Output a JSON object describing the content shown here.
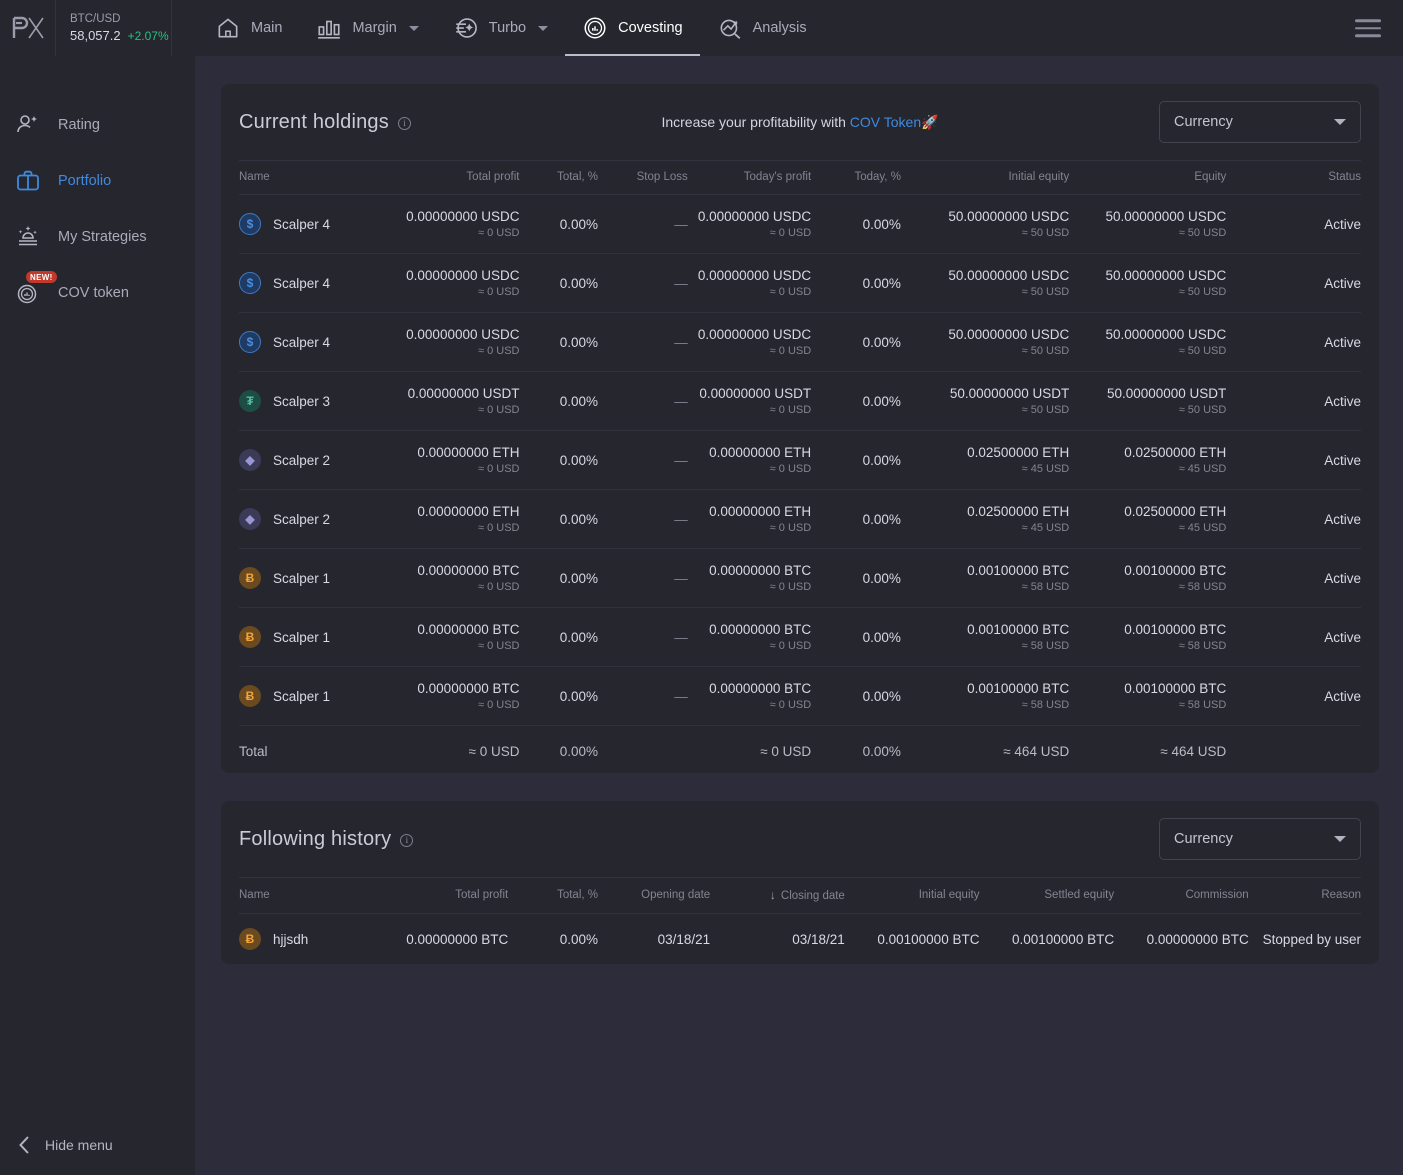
{
  "topbar": {
    "logo": "px-logo",
    "ticker": {
      "pair": "BTC/USD",
      "price": "58,057.2",
      "change": "+2.07%",
      "change_color": "#26c281"
    },
    "nav": [
      {
        "label": "Main",
        "icon": "home-icon",
        "has_caret": false,
        "active": false
      },
      {
        "label": "Margin",
        "icon": "bar-chart-icon",
        "has_caret": true,
        "active": false
      },
      {
        "label": "Turbo",
        "icon": "turbo-icon",
        "has_caret": true,
        "active": false
      },
      {
        "label": "Covesting",
        "icon": "covesting-icon",
        "has_caret": false,
        "active": true
      },
      {
        "label": "Analysis",
        "icon": "analysis-icon",
        "has_caret": false,
        "active": false
      }
    ],
    "menu_icon": "hamburger-icon"
  },
  "sidebar": {
    "items": [
      {
        "label": "Rating",
        "icon": "rating-user-icon",
        "active": false,
        "badge": ""
      },
      {
        "label": "Portfolio",
        "icon": "briefcase-icon",
        "active": true,
        "badge": ""
      },
      {
        "label": "My Strategies",
        "icon": "strategies-icon",
        "active": false,
        "badge": ""
      },
      {
        "label": "COV token",
        "icon": "cov-token-icon",
        "active": false,
        "badge": "NEW!"
      }
    ],
    "hide_menu": {
      "label": "Hide menu",
      "icon": "chevron-left-icon"
    },
    "accent_color": "#3f8ae0"
  },
  "holdings": {
    "title": "Current holdings",
    "info_icon": "info-icon",
    "promo_prefix": "Increase your profitability with ",
    "promo_link": "COV Token",
    "promo_emoji": "🚀",
    "currency_select": {
      "value": "Currency",
      "icon": "chevron-down-icon"
    },
    "columns": [
      "Name",
      "Total profit",
      "Total, %",
      "Stop Loss",
      "Today's profit",
      "Today, %",
      "Initial equity",
      "Equity",
      "Status"
    ],
    "rows": [
      {
        "coin": "usdc",
        "coin_glyph": "$",
        "name": "Scalper 4",
        "total_profit": "0.00000000 USDC",
        "total_profit_sub": "≈ 0 USD",
        "total_pct": "0.00%",
        "stop_loss": "—",
        "today_profit": "0.00000000 USDC",
        "today_profit_sub": "≈ 0 USD",
        "today_pct": "0.00%",
        "initial_equity": "50.00000000 USDC",
        "initial_equity_sub": "≈ 50 USD",
        "equity": "50.00000000 USDC",
        "equity_sub": "≈ 50 USD",
        "status": "Active"
      },
      {
        "coin": "usdc",
        "coin_glyph": "$",
        "name": "Scalper 4",
        "total_profit": "0.00000000 USDC",
        "total_profit_sub": "≈ 0 USD",
        "total_pct": "0.00%",
        "stop_loss": "—",
        "today_profit": "0.00000000 USDC",
        "today_profit_sub": "≈ 0 USD",
        "today_pct": "0.00%",
        "initial_equity": "50.00000000 USDC",
        "initial_equity_sub": "≈ 50 USD",
        "equity": "50.00000000 USDC",
        "equity_sub": "≈ 50 USD",
        "status": "Active"
      },
      {
        "coin": "usdc",
        "coin_glyph": "$",
        "name": "Scalper 4",
        "total_profit": "0.00000000 USDC",
        "total_profit_sub": "≈ 0 USD",
        "total_pct": "0.00%",
        "stop_loss": "—",
        "today_profit": "0.00000000 USDC",
        "today_profit_sub": "≈ 0 USD",
        "today_pct": "0.00%",
        "initial_equity": "50.00000000 USDC",
        "initial_equity_sub": "≈ 50 USD",
        "equity": "50.00000000 USDC",
        "equity_sub": "≈ 50 USD",
        "status": "Active"
      },
      {
        "coin": "usdt",
        "coin_glyph": "₮",
        "name": "Scalper 3",
        "total_profit": "0.00000000 USDT",
        "total_profit_sub": "≈ 0 USD",
        "total_pct": "0.00%",
        "stop_loss": "—",
        "today_profit": "0.00000000 USDT",
        "today_profit_sub": "≈ 0 USD",
        "today_pct": "0.00%",
        "initial_equity": "50.00000000 USDT",
        "initial_equity_sub": "≈ 50 USD",
        "equity": "50.00000000 USDT",
        "equity_sub": "≈ 50 USD",
        "status": "Active"
      },
      {
        "coin": "eth",
        "coin_glyph": "◆",
        "name": "Scalper 2",
        "total_profit": "0.00000000 ETH",
        "total_profit_sub": "≈ 0 USD",
        "total_pct": "0.00%",
        "stop_loss": "—",
        "today_profit": "0.00000000 ETH",
        "today_profit_sub": "≈ 0 USD",
        "today_pct": "0.00%",
        "initial_equity": "0.02500000 ETH",
        "initial_equity_sub": "≈ 45 USD",
        "equity": "0.02500000 ETH",
        "equity_sub": "≈ 45 USD",
        "status": "Active"
      },
      {
        "coin": "eth",
        "coin_glyph": "◆",
        "name": "Scalper 2",
        "total_profit": "0.00000000 ETH",
        "total_profit_sub": "≈ 0 USD",
        "total_pct": "0.00%",
        "stop_loss": "—",
        "today_profit": "0.00000000 ETH",
        "today_profit_sub": "≈ 0 USD",
        "today_pct": "0.00%",
        "initial_equity": "0.02500000 ETH",
        "initial_equity_sub": "≈ 45 USD",
        "equity": "0.02500000 ETH",
        "equity_sub": "≈ 45 USD",
        "status": "Active"
      },
      {
        "coin": "btc",
        "coin_glyph": "Ƀ",
        "name": "Scalper 1",
        "total_profit": "0.00000000 BTC",
        "total_profit_sub": "≈ 0 USD",
        "total_pct": "0.00%",
        "stop_loss": "—",
        "today_profit": "0.00000000 BTC",
        "today_profit_sub": "≈ 0 USD",
        "today_pct": "0.00%",
        "initial_equity": "0.00100000 BTC",
        "initial_equity_sub": "≈ 58 USD",
        "equity": "0.00100000 BTC",
        "equity_sub": "≈ 58 USD",
        "status": "Active"
      },
      {
        "coin": "btc",
        "coin_glyph": "Ƀ",
        "name": "Scalper 1",
        "total_profit": "0.00000000 BTC",
        "total_profit_sub": "≈ 0 USD",
        "total_pct": "0.00%",
        "stop_loss": "—",
        "today_profit": "0.00000000 BTC",
        "today_profit_sub": "≈ 0 USD",
        "today_pct": "0.00%",
        "initial_equity": "0.00100000 BTC",
        "initial_equity_sub": "≈ 58 USD",
        "equity": "0.00100000 BTC",
        "equity_sub": "≈ 58 USD",
        "status": "Active"
      },
      {
        "coin": "btc",
        "coin_glyph": "Ƀ",
        "name": "Scalper 1",
        "total_profit": "0.00000000 BTC",
        "total_profit_sub": "≈ 0 USD",
        "total_pct": "0.00%",
        "stop_loss": "—",
        "today_profit": "0.00000000 BTC",
        "today_profit_sub": "≈ 0 USD",
        "today_pct": "0.00%",
        "initial_equity": "0.00100000 BTC",
        "initial_equity_sub": "≈ 58 USD",
        "equity": "0.00100000 BTC",
        "equity_sub": "≈ 58 USD",
        "status": "Active"
      }
    ],
    "total": {
      "label": "Total",
      "total_profit": "≈ 0 USD",
      "total_pct": "0.00%",
      "stop_loss": "",
      "today_profit": "≈ 0 USD",
      "today_pct": "0.00%",
      "initial_equity": "≈ 464 USD",
      "equity": "≈ 464 USD",
      "status": ""
    }
  },
  "history": {
    "title": "Following history",
    "info_icon": "info-icon",
    "currency_select": {
      "value": "Currency",
      "icon": "chevron-down-icon"
    },
    "columns": [
      "Name",
      "Total profit",
      "Total, %",
      "Opening date",
      "Closing date",
      "Initial equity",
      "Settled equity",
      "Commission",
      "Reason"
    ],
    "sorted_column": "Closing date",
    "sort_icon": "arrow-down-icon",
    "rows": [
      {
        "coin": "btc",
        "coin_glyph": "Ƀ",
        "name": "hjjsdh",
        "total_profit": "0.00000000 BTC",
        "total_pct": "0.00%",
        "opening_date": "03/18/21",
        "closing_date": "03/18/21",
        "initial_equity": "0.00100000 BTC",
        "settled_equity": "0.00100000 BTC",
        "commission": "0.00000000 BTC",
        "reason": "Stopped by user"
      }
    ]
  }
}
